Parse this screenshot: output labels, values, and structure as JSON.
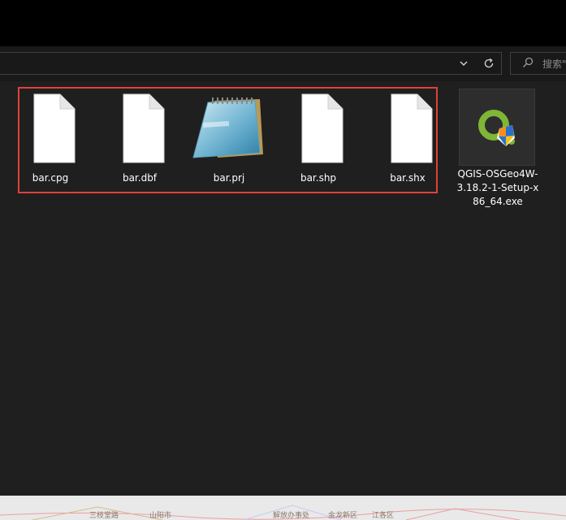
{
  "search": {
    "placeholder": "搜索\""
  },
  "files": [
    {
      "name": "bar.cpg",
      "icon": "blank-file-icon"
    },
    {
      "name": "bar.dbf",
      "icon": "blank-file-icon"
    },
    {
      "name": "bar.prj",
      "icon": "notepad-icon"
    },
    {
      "name": "bar.shp",
      "icon": "blank-file-icon"
    },
    {
      "name": "bar.shx",
      "icon": "blank-file-icon"
    }
  ],
  "exe": {
    "name": "QGIS-OSGeo4W-3.18.2-1-Setup-x86_64.exe",
    "icon": "qgis-installer-icon"
  },
  "colors": {
    "selection": "#e0403a",
    "background": "#1f1f1f",
    "qgis_green": "#7fb636",
    "qgis_orange": "#f2911d"
  },
  "map_strip": {
    "labels": [
      "三枝堂路",
      "山阳市",
      "解放办事处",
      "金龙新区",
      "江各区"
    ]
  }
}
